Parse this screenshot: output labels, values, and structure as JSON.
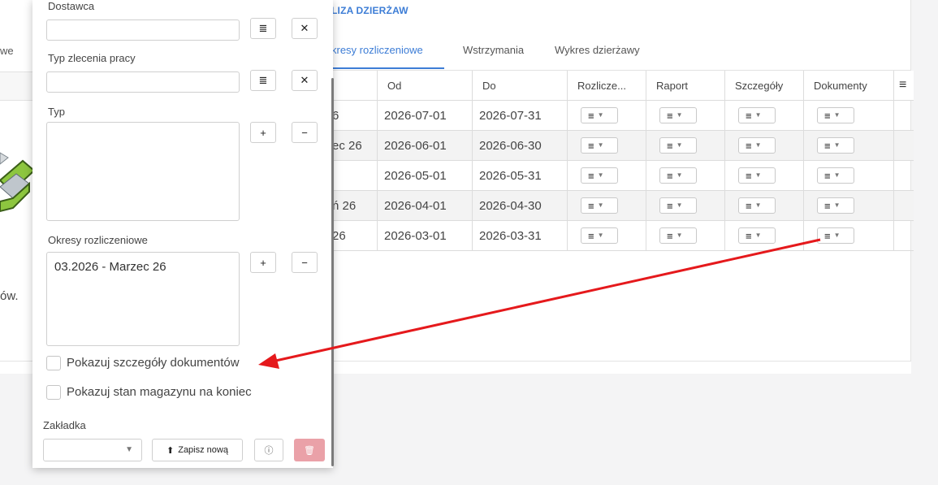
{
  "header": {
    "breadcrumb_fragment": "LIZA DZIERŻAW"
  },
  "left_context": {
    "tab_fragment": "we",
    "text_fragment": "ów."
  },
  "tabs": [
    {
      "label": "kresy rozliczeniowe",
      "active": true
    },
    {
      "label": "Wstrzymania",
      "active": false
    },
    {
      "label": "Wykres dzierżawy",
      "active": false
    }
  ],
  "table": {
    "columns": [
      "Od",
      "Do",
      "Rozlicze...",
      "Raport",
      "Szczegóły",
      "Dokumenty"
    ],
    "menu_icon": "hamburger-icon",
    "rows": [
      {
        "name_fragment": "6",
        "od": "2026-07-01",
        "do": "2026-07-31"
      },
      {
        "name_fragment": "ec 26",
        "od": "2026-06-01",
        "do": "2026-06-30"
      },
      {
        "name_fragment": "",
        "od": "2026-05-01",
        "do": "2026-05-31"
      },
      {
        "name_fragment": "ń 26",
        "od": "2026-04-01",
        "do": "2026-04-30"
      },
      {
        "name_fragment": "26",
        "od": "2026-03-01",
        "do": "2026-03-31"
      }
    ]
  },
  "filter_panel": {
    "dostawca_label": "Dostawca",
    "typ_zlecenia_label": "Typ zlecenia pracy",
    "typ_label": "Typ",
    "okresy_label": "Okresy rozliczeniowe",
    "okresy_item": "03.2026 - Marzec 26",
    "checkbox_details": "Pokazuj szczegóły dokumentów",
    "checkbox_stock": "Pokazuj stan magazynu na koniec",
    "zakladka_label": "Zakładka",
    "save_new_label": "Zapisz nową",
    "plus_glyph": "+",
    "minus_glyph": "−",
    "clear_glyph": "✕",
    "list_glyph": "≣"
  },
  "colors": {
    "accent": "#3d7dd6",
    "arrow": "#e5191c",
    "delete_button": "#eaa1a8"
  }
}
